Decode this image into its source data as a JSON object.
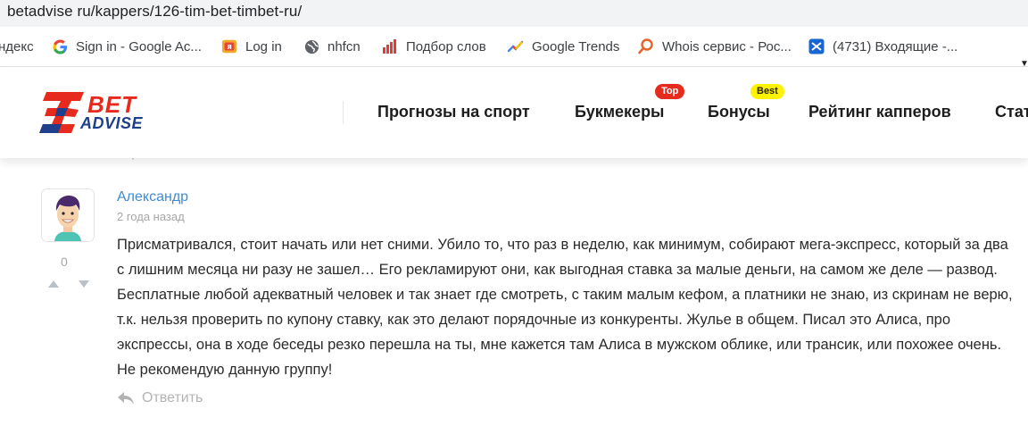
{
  "browser": {
    "url": "betadvise ru/kappers/126-tim-bet-timbet-ru/"
  },
  "bookmarks": [
    {
      "label": "ндекс",
      "icon": "none"
    },
    {
      "label": "Sign in - Google Ac...",
      "icon": "google-icon"
    },
    {
      "label": "Log in",
      "icon": "login-site-icon"
    },
    {
      "label": "nhfcn",
      "icon": "globe-icon"
    },
    {
      "label": "Подбор слов",
      "icon": "bar-chart-icon"
    },
    {
      "label": "Google Trends",
      "icon": "trends-icon"
    },
    {
      "label": "Whois сервис - Рос...",
      "icon": "search-icon"
    },
    {
      "label": "(4731) Входящие -...",
      "icon": "mail-icon"
    }
  ],
  "site": {
    "logo": {
      "bet": "BET",
      "advise": "ADVISE"
    },
    "nav": [
      {
        "label": "Прогнозы на спорт"
      },
      {
        "label": "Букмекеры",
        "badge": "Top"
      },
      {
        "label": "Бонусы",
        "badge": "Best"
      },
      {
        "label": "Рейтинг капперов"
      },
      {
        "label": "Стат"
      }
    ]
  },
  "comment": {
    "author": "Александр",
    "date": "2 года назад",
    "votes": "0",
    "text": "Присматривался, стоит начать или нет сними. Убило то, что раз в неделю, как минимум, собирают мега-экспресс, который за два с лишним месяца ни разу не зашел… Его рекламируют они, как выгодная ставка за малые деньги, на самом же деле — развод. Бесплатные любой адекватный человек и так знает где смотреть, с таким малым кефом, а платники не знаю, из скринам не верю, т.к. нельзя проверить по купону ставку, как это делают порядочные из конкуренты. Жулье в общем. Писал это Алиса, про экспрессы, она в ходе беседы резко перешла на ты, мне кажется там Алиса в мужском облике, или трансик, или похожее очень. Не рекомендую данную группу!",
    "reply_label": "Ответить"
  },
  "colors": {
    "brand_red": "#e62b1e",
    "brand_blue": "#1d3f8c",
    "badge_best": "#fff200",
    "author_link": "#3d8bd6",
    "muted": "#a7a7a7"
  }
}
